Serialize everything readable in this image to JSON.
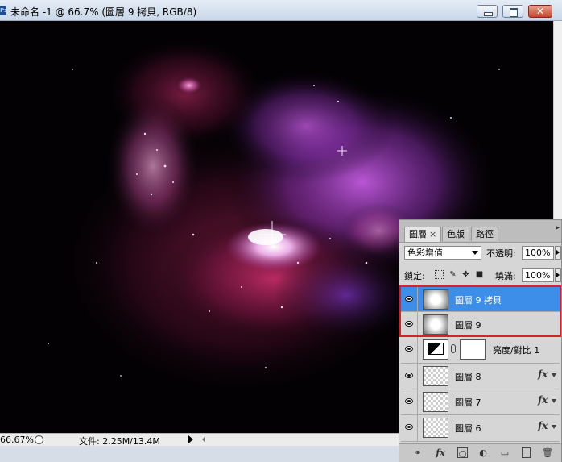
{
  "window": {
    "app_icon": "Ps",
    "title": "未命名 -1 @ 66.7% (圖層 9 拷貝, RGB/8)"
  },
  "canvas": {
    "palette": [
      "#000000",
      "#c0306a",
      "#a040c0",
      "#e090e0",
      "#ffffff"
    ]
  },
  "statusbar": {
    "zoom": "66.67%",
    "doc_info": "文件: 2.25M/13.4M"
  },
  "layers_panel": {
    "tabs": [
      {
        "label": "圖層",
        "close": "×",
        "active": true
      },
      {
        "label": "色版",
        "active": false
      },
      {
        "label": "路徑",
        "active": false
      }
    ],
    "blend_mode": "色彩增值",
    "opacity_label": "不透明:",
    "opacity_value": "100%",
    "lock_label": "鎖定:",
    "fill_label": "填滿:",
    "fill_value": "100%",
    "layers": [
      {
        "name": "圖層 9 拷貝",
        "thumb": "glow",
        "selected": true,
        "visible": true
      },
      {
        "name": "圖層 9",
        "thumb": "glow",
        "selected": false,
        "visible": true
      },
      {
        "name": "亮度/對比 1",
        "thumb": "adjustment",
        "selected": false,
        "visible": true
      },
      {
        "name": "圖層 8",
        "thumb": "transparent",
        "fx": "fx",
        "visible": true
      },
      {
        "name": "圖層 7",
        "thumb": "transparent",
        "fx": "fx",
        "visible": true
      },
      {
        "name": "圖層 6",
        "thumb": "transparent",
        "fx": "fx",
        "visible": true
      }
    ],
    "highlight_color": "#d8202b",
    "selection_color": "#3d8ee8",
    "bottom_icons": [
      "link-icon",
      "fx-icon",
      "mask-icon",
      "adjustment-icon",
      "group-icon",
      "new-layer-icon",
      "trash-icon"
    ]
  }
}
